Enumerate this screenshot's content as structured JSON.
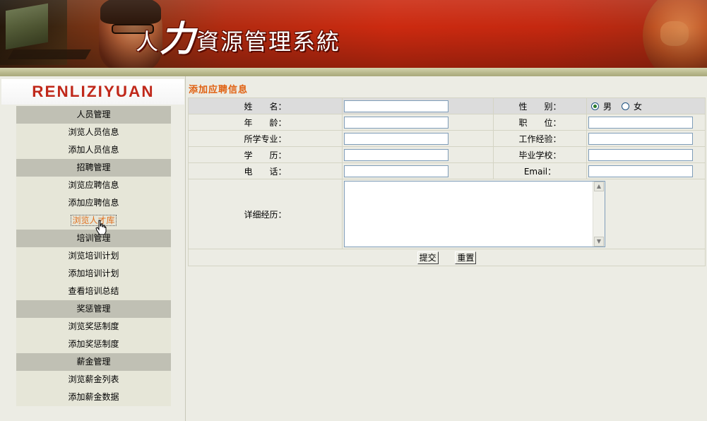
{
  "banner": {
    "title_part1": "人",
    "title_part2": "力",
    "title_part3": "資源管理系統"
  },
  "sidebar": {
    "logo": "RENLIZIYUAN",
    "groups": [
      {
        "heading": "人员管理",
        "items": [
          "浏览人员信息",
          "添加人员信息"
        ]
      },
      {
        "heading": "招聘管理",
        "items": [
          "浏览应聘信息",
          "添加应聘信息",
          "浏览人才库"
        ]
      },
      {
        "heading": "培训管理",
        "items": [
          "浏览培训计划",
          "添加培训计划",
          "查看培训总结"
        ]
      },
      {
        "heading": "奖惩管理",
        "items": [
          "浏览奖惩制度",
          "添加奖惩制度"
        ]
      },
      {
        "heading": "薪金管理",
        "items": [
          "浏览薪金列表",
          "添加薪金数据"
        ]
      }
    ],
    "active_item": "浏览人才库"
  },
  "form": {
    "title": "添加应聘信息",
    "labels": {
      "name": "姓　　名：",
      "gender": "性　　别：",
      "age": "年　　龄：",
      "position": "职　　位：",
      "major": "所学专业：",
      "experience": "工作经验：",
      "education": "学　　历：",
      "school": "毕业学校：",
      "phone": "电　　话：",
      "email": "Email：",
      "resume": "详细经历："
    },
    "gender_options": [
      "男",
      "女"
    ],
    "gender_selected": "男",
    "values": {
      "name": "",
      "age": "",
      "major": "",
      "education": "",
      "phone": "",
      "position": "",
      "experience": "",
      "school": "",
      "email": "",
      "resume": ""
    },
    "submit_label": "提交",
    "reset_label": "重置"
  },
  "colors": {
    "banner_red": "#cc2a10",
    "menu_heading_bg": "#c0c0b4",
    "menu_item_bg": "#e6e6d8",
    "form_title": "#e06010",
    "logo_red": "#c0281a",
    "active_link": "#e07020"
  }
}
